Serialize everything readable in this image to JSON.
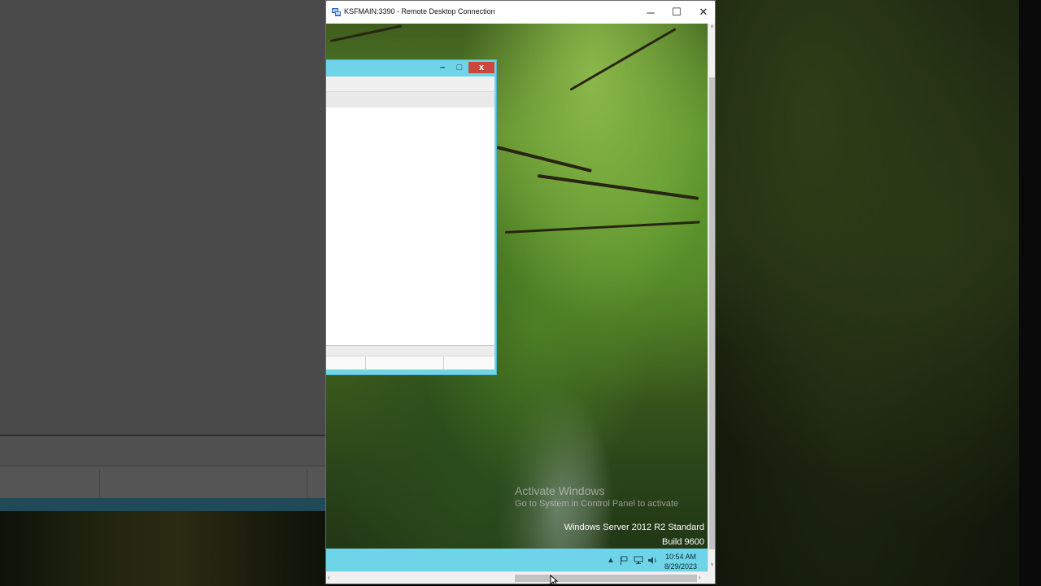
{
  "rdp": {
    "title": "KSFMAIN:3390 - Remote Desktop Connection",
    "controls": {
      "minimize": "─",
      "maximize": "☐",
      "close": "✕"
    }
  },
  "inner_window": {
    "controls": {
      "minimize": "–",
      "maximize": "□",
      "close": "x"
    }
  },
  "watermark": {
    "activate": "Activate Windows",
    "goto": "Go to System in Control Panel to activate",
    "edition": "Windows Server 2012 R2 Standard",
    "build": "Build 9600"
  },
  "taskbar": {
    "tray_time": "10:54 AM",
    "tray_date": "8/29/2023",
    "tray_icons": [
      "chevron-up-icon",
      "flag-icon",
      "network-icon",
      "speaker-icon"
    ]
  },
  "scroll": {
    "left_arrow": "‹",
    "right_arrow": "›",
    "up_arrow": "˄",
    "down_arrow": "˅"
  },
  "colors": {
    "taskbar": "#6fd4e8",
    "inner_close": "#c9473d",
    "outer_left": "#4a4a4a"
  }
}
